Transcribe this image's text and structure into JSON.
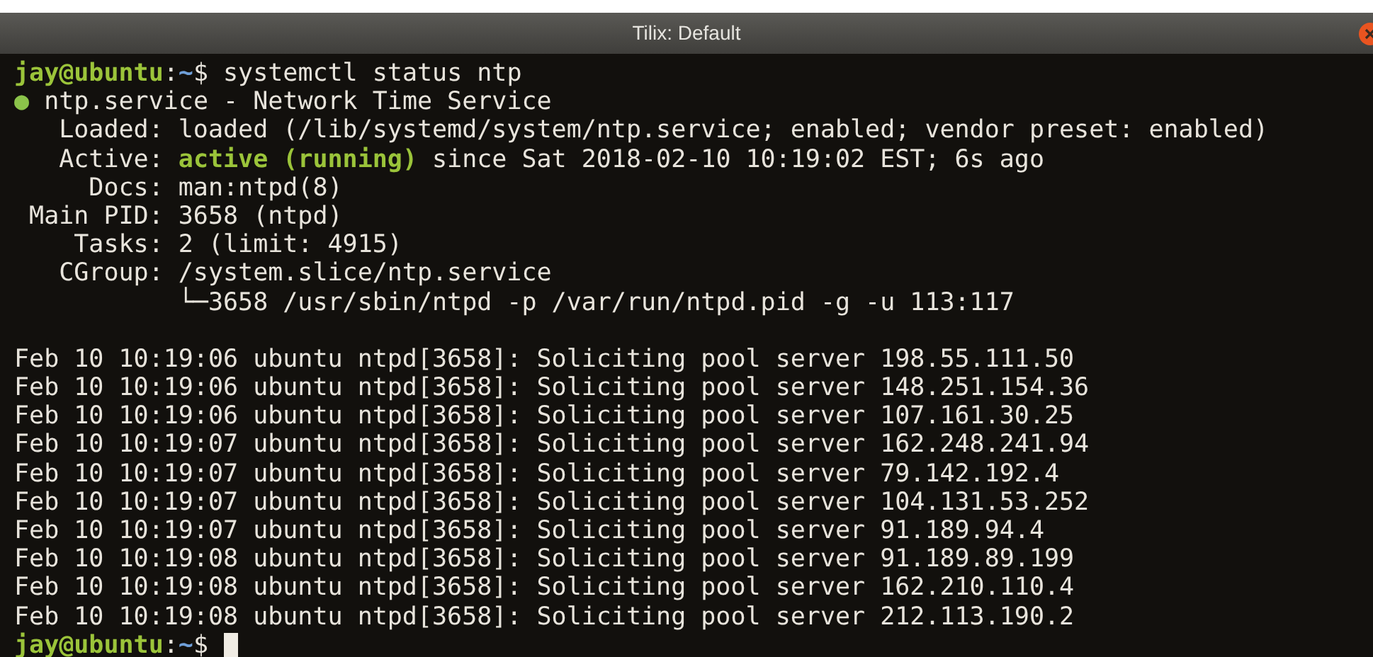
{
  "window": {
    "title": "Tilix: Default"
  },
  "terminal": {
    "lines": [
      {
        "kind": "text",
        "segments": [
          {
            "kind": "user",
            "text": "jay@ubuntu"
          },
          {
            "kind": "plain",
            "text": ":"
          },
          {
            "kind": "path",
            "text": "~"
          },
          {
            "kind": "plain",
            "text": "$ systemctl status ntp"
          }
        ]
      },
      {
        "kind": "text",
        "segments": [
          {
            "kind": "dot",
            "text": "●"
          },
          {
            "kind": "plain",
            "text": " ntp.service - Network Time Service"
          }
        ]
      },
      {
        "kind": "text",
        "segments": [
          {
            "kind": "plain",
            "text": "   Loaded: loaded (/lib/systemd/system/ntp.service; enabled; vendor preset: enabled)"
          }
        ]
      },
      {
        "kind": "text",
        "segments": [
          {
            "kind": "plain",
            "text": "   Active: "
          },
          {
            "kind": "active",
            "text": "active (running)"
          },
          {
            "kind": "plain",
            "text": " since Sat 2018-02-10 10:19:02 EST; 6s ago"
          }
        ]
      },
      {
        "kind": "text",
        "segments": [
          {
            "kind": "plain",
            "text": "     Docs: man:ntpd(8)"
          }
        ]
      },
      {
        "kind": "text",
        "segments": [
          {
            "kind": "plain",
            "text": " Main PID: 3658 (ntpd)"
          }
        ]
      },
      {
        "kind": "text",
        "segments": [
          {
            "kind": "plain",
            "text": "    Tasks: 2 (limit: 4915)"
          }
        ]
      },
      {
        "kind": "text",
        "segments": [
          {
            "kind": "plain",
            "text": "   CGroup: /system.slice/ntp.service"
          }
        ]
      },
      {
        "kind": "text",
        "segments": [
          {
            "kind": "plain",
            "text": "           └─3658 /usr/sbin/ntpd -p /var/run/ntpd.pid -g -u 113:117"
          }
        ]
      },
      {
        "kind": "blank"
      },
      {
        "kind": "text",
        "segments": [
          {
            "kind": "plain",
            "text": "Feb 10 10:19:06 ubuntu ntpd[3658]: Soliciting pool server 198.55.111.50"
          }
        ]
      },
      {
        "kind": "text",
        "segments": [
          {
            "kind": "plain",
            "text": "Feb 10 10:19:06 ubuntu ntpd[3658]: Soliciting pool server 148.251.154.36"
          }
        ]
      },
      {
        "kind": "text",
        "segments": [
          {
            "kind": "plain",
            "text": "Feb 10 10:19:06 ubuntu ntpd[3658]: Soliciting pool server 107.161.30.25"
          }
        ]
      },
      {
        "kind": "text",
        "segments": [
          {
            "kind": "plain",
            "text": "Feb 10 10:19:07 ubuntu ntpd[3658]: Soliciting pool server 162.248.241.94"
          }
        ]
      },
      {
        "kind": "text",
        "segments": [
          {
            "kind": "plain",
            "text": "Feb 10 10:19:07 ubuntu ntpd[3658]: Soliciting pool server 79.142.192.4"
          }
        ]
      },
      {
        "kind": "text",
        "segments": [
          {
            "kind": "plain",
            "text": "Feb 10 10:19:07 ubuntu ntpd[3658]: Soliciting pool server 104.131.53.252"
          }
        ]
      },
      {
        "kind": "text",
        "segments": [
          {
            "kind": "plain",
            "text": "Feb 10 10:19:07 ubuntu ntpd[3658]: Soliciting pool server 91.189.94.4"
          }
        ]
      },
      {
        "kind": "text",
        "segments": [
          {
            "kind": "plain",
            "text": "Feb 10 10:19:08 ubuntu ntpd[3658]: Soliciting pool server 91.189.89.199"
          }
        ]
      },
      {
        "kind": "text",
        "segments": [
          {
            "kind": "plain",
            "text": "Feb 10 10:19:08 ubuntu ntpd[3658]: Soliciting pool server 162.210.110.4"
          }
        ]
      },
      {
        "kind": "text",
        "segments": [
          {
            "kind": "plain",
            "text": "Feb 10 10:19:08 ubuntu ntpd[3658]: Soliciting pool server 212.113.190.2"
          }
        ]
      }
    ],
    "prompt": {
      "segments": [
        {
          "kind": "user",
          "text": "jay@ubuntu"
        },
        {
          "kind": "plain",
          "text": ":"
        },
        {
          "kind": "path",
          "text": "~"
        },
        {
          "kind": "plain",
          "text": "$ "
        }
      ],
      "cursor": true
    }
  }
}
